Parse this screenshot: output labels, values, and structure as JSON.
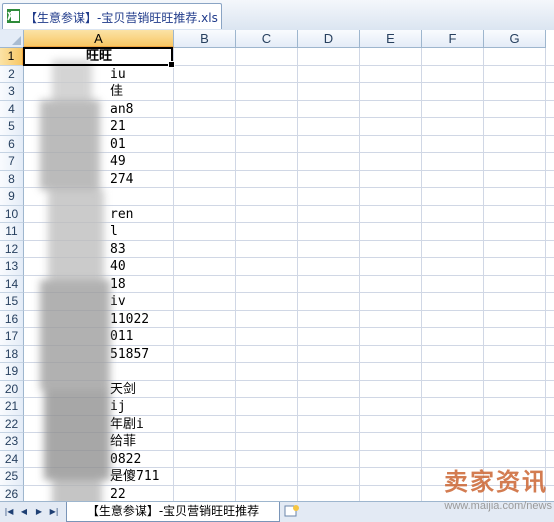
{
  "window": {
    "tab_title": "【生意参谋】-宝贝营销旺旺推荐.xls",
    "file_icon": "excel-icon"
  },
  "sheet": {
    "columns": [
      "A",
      "B",
      "C",
      "D",
      "E",
      "F",
      "G"
    ],
    "rows": [
      "1",
      "2",
      "3",
      "4",
      "5",
      "6",
      "7",
      "8",
      "9",
      "10",
      "11",
      "12",
      "13",
      "14",
      "15",
      "16",
      "17",
      "18",
      "19",
      "20",
      "21",
      "22",
      "23",
      "24",
      "25",
      "26"
    ],
    "column_a_header": "旺旺",
    "column_a_visible_fragments": [
      "iu",
      "佳",
      "an8",
      "21",
      "01",
      "49",
      "274",
      "",
      "ren",
      "l",
      "83",
      "40",
      "18",
      "iv",
      "11022",
      "011",
      "51857",
      "",
      "天剑",
      "ij",
      "年剧i",
      "给菲",
      "0822",
      "是傻711",
      "22"
    ],
    "selected_cell": "A1",
    "selected_column": "A",
    "selected_row": "1"
  },
  "sheet_tabs": {
    "nav_icons": [
      "first-sheet-icon",
      "prev-sheet-icon",
      "next-sheet-icon",
      "last-sheet-icon"
    ],
    "active_tab_label": "【生意参谋】-宝贝营销旺旺推荐",
    "new_sheet_icon": "insert-sheet-icon"
  },
  "watermark": {
    "brand": "卖家资讯",
    "url": "www.maijia.com/news"
  },
  "colors": {
    "header_bg": "#e4ecf7",
    "selected_header": "#f8c765",
    "gridline": "#d0d7e5",
    "tab_title": "#1f3a8a",
    "watermark": "#cc6633"
  }
}
